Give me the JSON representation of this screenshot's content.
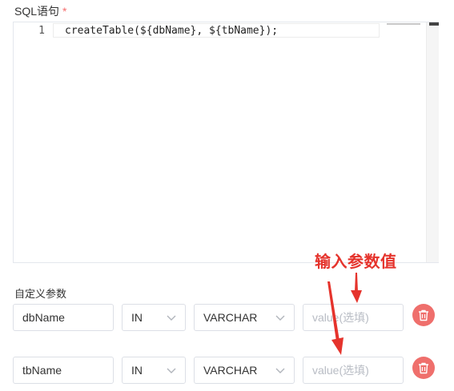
{
  "sql_label": "SQL语句",
  "required_mark": "*",
  "editor": {
    "line_number": "1",
    "code": "createTable(${dbName}, ${tbName});"
  },
  "params_label": "自定义参数",
  "params": [
    {
      "name": "dbName",
      "direction": "IN",
      "type": "VARCHAR",
      "value_placeholder": "value(选填)"
    },
    {
      "name": "tbName",
      "direction": "IN",
      "type": "VARCHAR",
      "value_placeholder": "value(选填)"
    }
  ],
  "annotation": "输入参数值",
  "colors": {
    "accent_red": "#e5332c",
    "delete_button": "#ef6f6c"
  },
  "icons": {
    "select": "chevron-down-icon",
    "delete": "trash-icon"
  }
}
